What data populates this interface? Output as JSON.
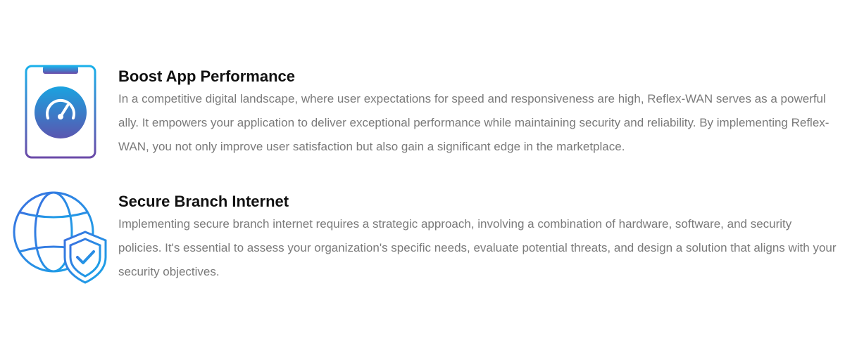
{
  "features": [
    {
      "icon": "speedometer-phone-icon",
      "title": "Boost App Performance",
      "description": "In a competitive digital landscape, where user expectations for speed and responsiveness are high, Reflex-WAN serves as a powerful ally. It empowers your application to deliver exceptional performance while maintaining security and reliability. By implementing Reflex-WAN, you not only improve user satisfaction but also gain a significant edge in the marketplace."
    },
    {
      "icon": "globe-shield-icon",
      "title": "Secure Branch Internet",
      "description": "Implementing secure branch internet requires a strategic approach, involving a combination of hardware, software, and security policies. It's essential to assess your organization's specific needs, evaluate potential threats, and design a solution that aligns with your security objectives."
    }
  ],
  "colors": {
    "gradient_blue": "#1aa7e8",
    "gradient_purple": "#6a4fb0",
    "title": "#111111",
    "body_text": "#7a7a7a"
  }
}
